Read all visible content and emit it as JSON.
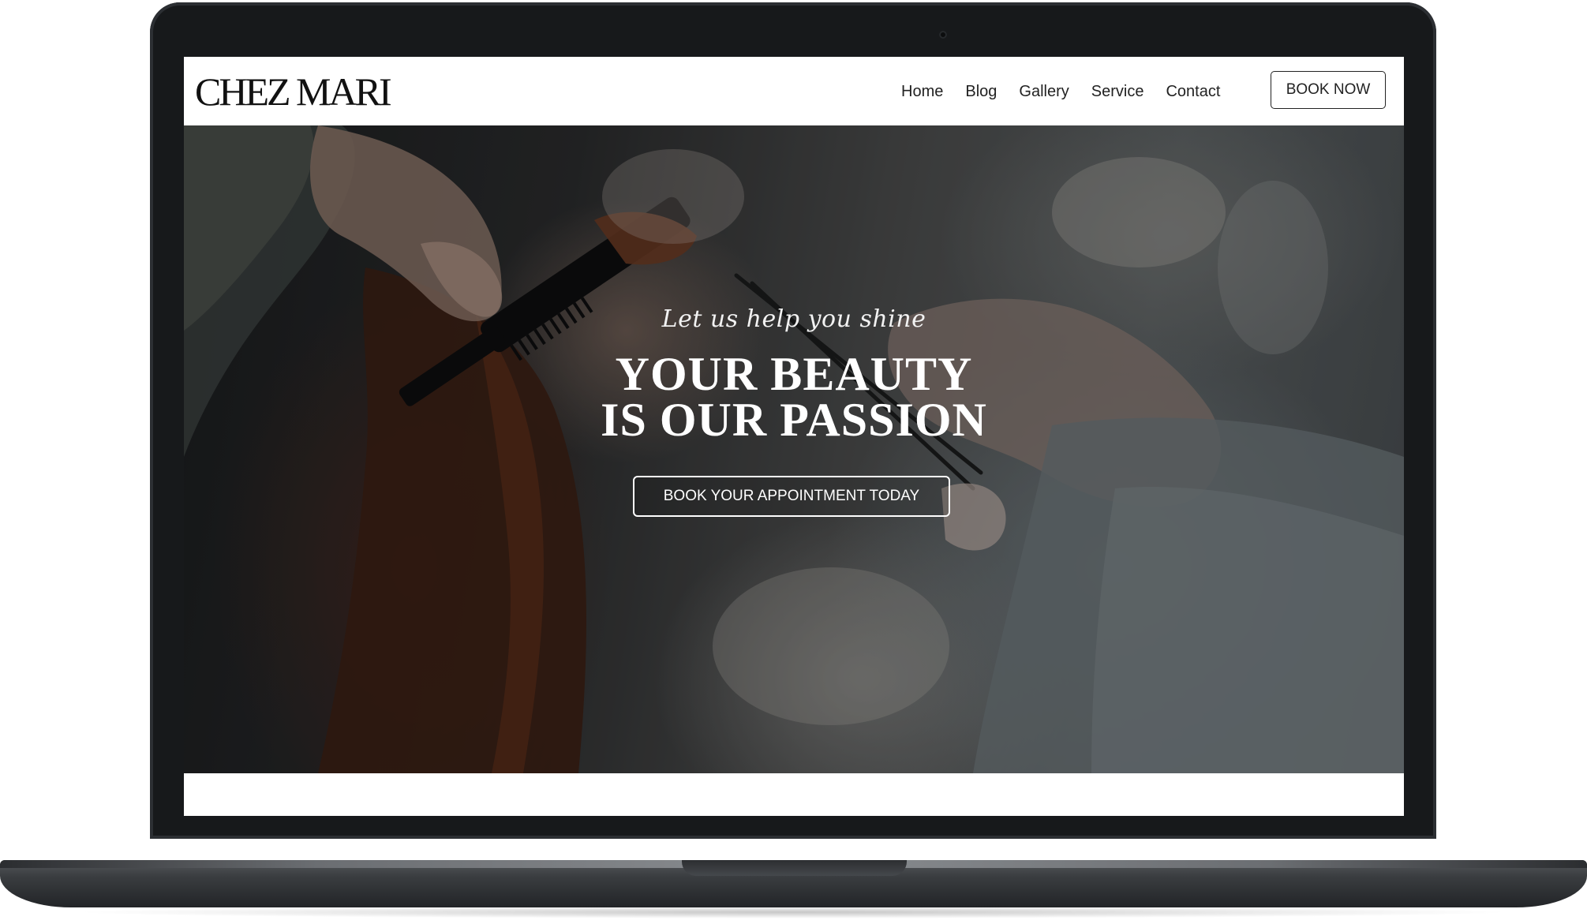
{
  "site": {
    "logo": "CHEZ MARI",
    "nav": [
      "Home",
      "Blog",
      "Gallery",
      "Service",
      "Contact"
    ],
    "book_now": "BOOK NOW"
  },
  "hero": {
    "tagline": "Let us help you shine",
    "title_line1": "YOUR BEAUTY",
    "title_line2": "IS OUR PASSION",
    "cta": "BOOK YOUR APPOINTMENT TODAY"
  },
  "colors": {
    "header_bg": "#ffffff",
    "text_dark": "#222222",
    "hero_text": "#ffffff",
    "device_frame": "#17191b"
  }
}
